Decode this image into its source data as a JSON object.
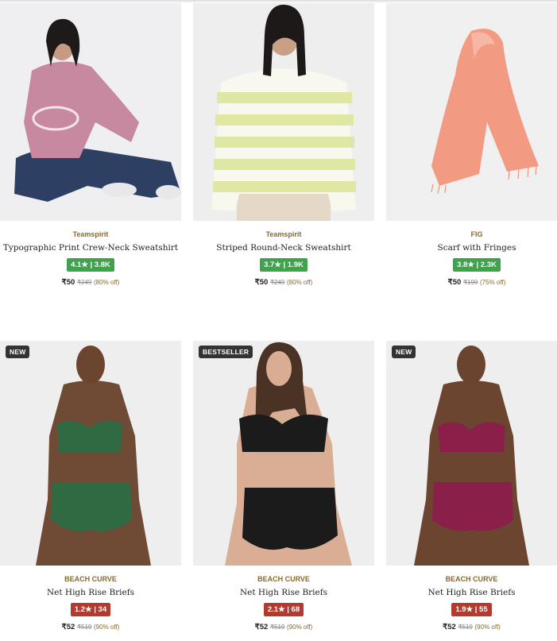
{
  "products": [
    {
      "brand": "Teamspirit",
      "name": "Typographic Print Crew-Neck Sweatshirt",
      "rating": "4.1★ | 3.8K",
      "price": "₹50",
      "mrp": "₹249",
      "discount": "(80% off)",
      "badge": ""
    },
    {
      "brand": "Teamspirit",
      "name": "Striped Round-Neck Sweatshirt",
      "rating": "3.7★ | 1.9K",
      "price": "₹50",
      "mrp": "₹249",
      "discount": "(80% off)",
      "badge": ""
    },
    {
      "brand": "FIG",
      "name": "Scarf with Fringes",
      "rating": "3.8★ | 2.3K",
      "price": "₹50",
      "mrp": "₹199",
      "discount": "(75% off)",
      "badge": ""
    },
    {
      "brand": "BEACH CURVE",
      "name": "Net High Rise Briefs",
      "rating": "1.2★ | 34",
      "price": "₹52",
      "mrp": "₹519",
      "discount": "(90% off)",
      "badge": "NEW"
    },
    {
      "brand": "BEACH CURVE",
      "name": "Net High Rise Briefs",
      "rating": "2.1★ | 68",
      "price": "₹52",
      "mrp": "₹519",
      "discount": "(90% off)",
      "badge": "BESTSELLER"
    },
    {
      "brand": "BEACH CURVE",
      "name": "Net High Rise Briefs",
      "rating": "1.9★ | 55",
      "price": "₹52",
      "mrp": "₹519",
      "discount": "(90% off)",
      "badge": "NEW"
    }
  ],
  "colors": {
    "rating_good": "#3fa34d",
    "rating_bad": "#b23a2e",
    "brand": "#8a6a2c"
  }
}
